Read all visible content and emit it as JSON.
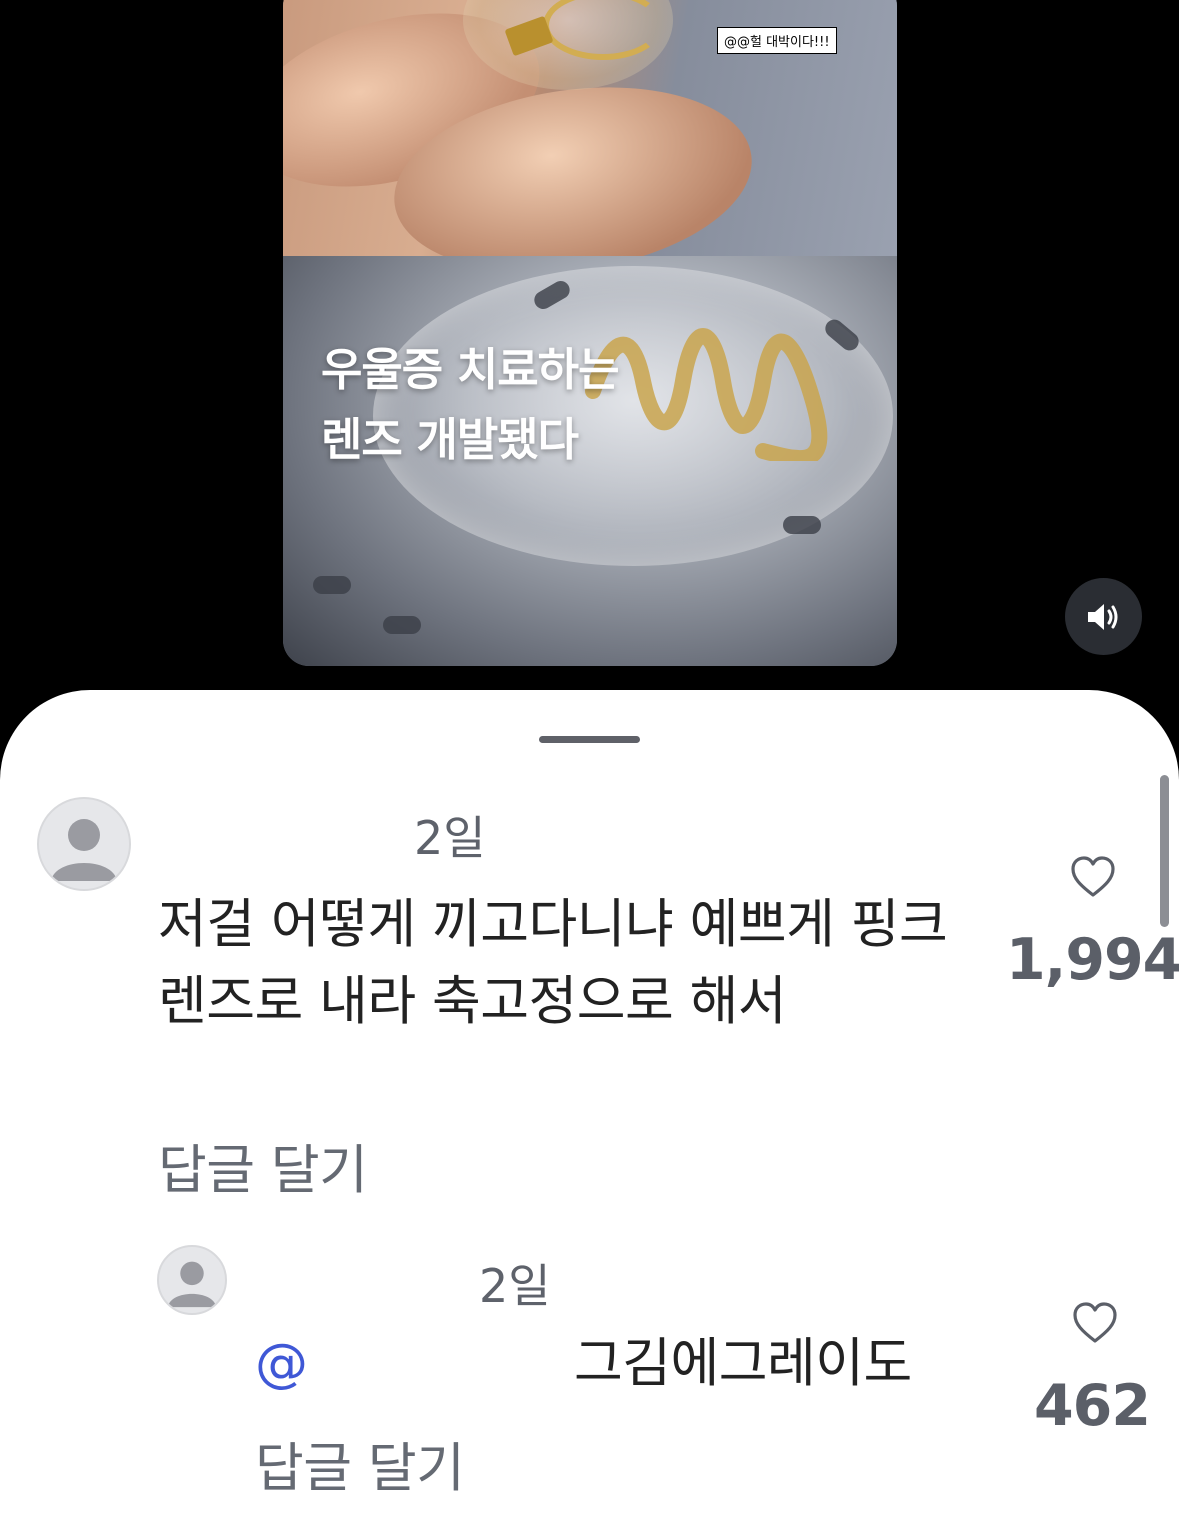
{
  "video": {
    "watermark": "@@헐 대박이다!!!",
    "title_line1": "우울증 치료하는",
    "title_line2": "렌즈 개발됐다",
    "sound_icon": "speaker-volume-icon"
  },
  "comments": [
    {
      "time": "2일",
      "text": "저걸 어떻게 끼고다니냐 예쁘게 핑크 렌즈로 내라 축고정으로 해서",
      "reply_label": "답글 달기",
      "likes": "1,994"
    },
    {
      "time": "2일",
      "mention": "@",
      "text": "그김에그레이도",
      "reply_label": "답글 달기",
      "likes": "462"
    }
  ],
  "colors": {
    "mention": "#3f58d6",
    "sheet_bg": "#ffffff",
    "background": "#000000"
  }
}
